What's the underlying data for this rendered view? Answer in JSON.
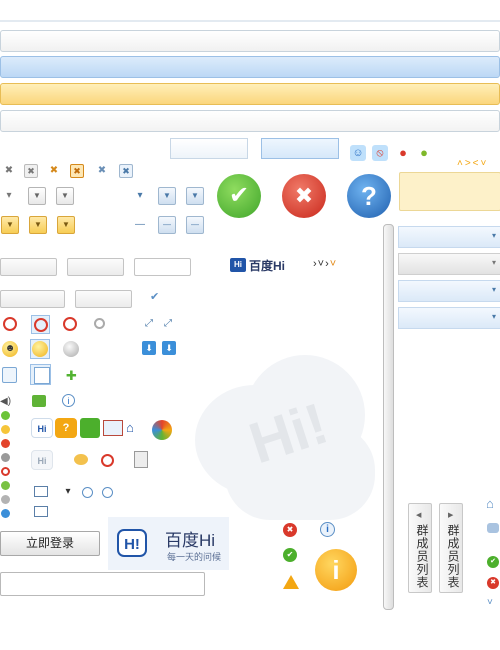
{
  "buttons": {
    "login_label": "立即登录"
  },
  "vertical_tabs": [
    {
      "label": "群成员列表"
    },
    {
      "label": "群成员列表"
    }
  ],
  "brand": {
    "small_logo_text": "百度Hi",
    "small_logo_badge": "Hi",
    "large_logo_badge": "H!",
    "large_logo_text": "百度Hi",
    "large_logo_slogan": "每一天的问候",
    "watermark_text": "Hi!"
  },
  "icons": {
    "check": "✔",
    "close": "✖",
    "question": "?",
    "info": "i",
    "warning": "!",
    "plus": "✚",
    "chevron_down": "▾",
    "chevron_left": "◀",
    "chevron_right": "▶"
  },
  "colors": {
    "green": "#3fa52a",
    "red": "#d9392b",
    "blue": "#2a6fc4",
    "orange": "#f3a713",
    "selected_blue": "#c5dcf6",
    "highlight_yellow": "#fde08a",
    "panel_yellow": "#fdf1c9"
  }
}
